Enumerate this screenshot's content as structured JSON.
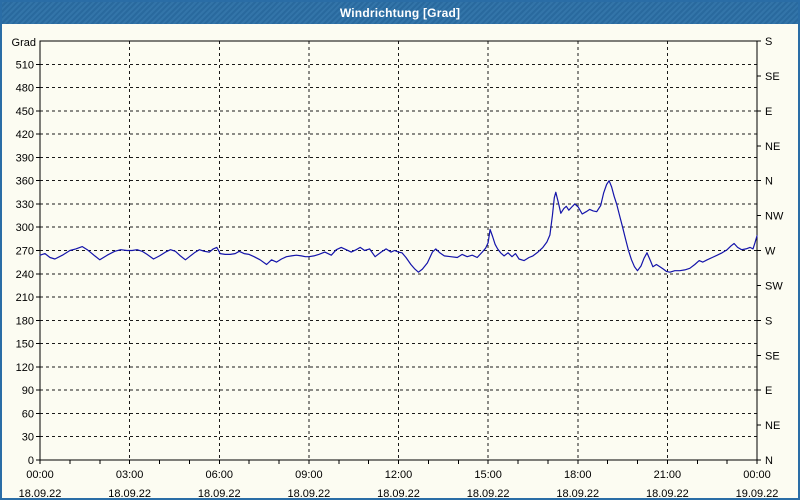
{
  "window": {
    "title": "Windrichtung [Grad]"
  },
  "colors": {
    "titlebar": "#2b6fa6",
    "window_border": "#2a6da6",
    "background": "#fcfcf2",
    "plot_border": "#000000",
    "gridline": "#1a1a1a",
    "axis_text": "#000000",
    "series_line": "#1414aa"
  },
  "chart_data": {
    "type": "line",
    "title": "Windrichtung [Grad]",
    "ylabel_left": "Grad",
    "xlabel": "",
    "grid": true,
    "legend": "none",
    "y_axis_left": {
      "min": 0,
      "max": 540,
      "tick_step": 30,
      "tick_labels": [
        "0",
        "30",
        "60",
        "90",
        "120",
        "150",
        "180",
        "210",
        "240",
        "270",
        "300",
        "330",
        "360",
        "390",
        "420",
        "450",
        "480",
        "510"
      ]
    },
    "y_axis_right": {
      "labels": [
        {
          "value": 0,
          "label": "N"
        },
        {
          "value": 45,
          "label": "NE"
        },
        {
          "value": 90,
          "label": "E"
        },
        {
          "value": 135,
          "label": "SE"
        },
        {
          "value": 180,
          "label": "S"
        },
        {
          "value": 225,
          "label": "SW"
        },
        {
          "value": 270,
          "label": "W"
        },
        {
          "value": 315,
          "label": "NW"
        },
        {
          "value": 360,
          "label": "N"
        },
        {
          "value": 405,
          "label": "NE"
        },
        {
          "value": 450,
          "label": "E"
        },
        {
          "value": 495,
          "label": "SE"
        },
        {
          "value": 540,
          "label": "S"
        }
      ]
    },
    "x_axis": {
      "minutes_total": 1440,
      "minor_tick_hours": 1,
      "ticks": [
        {
          "hour": 0,
          "time": "00:00",
          "date": "18.09.22"
        },
        {
          "hour": 3,
          "time": "03:00",
          "date": "18.09.22"
        },
        {
          "hour": 6,
          "time": "06:00",
          "date": "18.09.22"
        },
        {
          "hour": 9,
          "time": "09:00",
          "date": "18.09.22"
        },
        {
          "hour": 12,
          "time": "12:00",
          "date": "18.09.22"
        },
        {
          "hour": 15,
          "time": "15:00",
          "date": "18.09.22"
        },
        {
          "hour": 18,
          "time": "18:00",
          "date": "18.09.22"
        },
        {
          "hour": 21,
          "time": "21:00",
          "date": "18.09.22"
        },
        {
          "hour": 24,
          "time": "00:00",
          "date": "19.09.22"
        }
      ]
    },
    "series": [
      {
        "name": "Windrichtung",
        "unit": "Grad",
        "points": [
          [
            0,
            264
          ],
          [
            10,
            266
          ],
          [
            20,
            261
          ],
          [
            30,
            259
          ],
          [
            45,
            264
          ],
          [
            60,
            270
          ],
          [
            72,
            272
          ],
          [
            85,
            275
          ],
          [
            95,
            271
          ],
          [
            110,
            263
          ],
          [
            120,
            258
          ],
          [
            135,
            264
          ],
          [
            150,
            269
          ],
          [
            162,
            271
          ],
          [
            175,
            270
          ],
          [
            185,
            270
          ],
          [
            195,
            271
          ],
          [
            205,
            269
          ],
          [
            215,
            265
          ],
          [
            228,
            259
          ],
          [
            240,
            263
          ],
          [
            252,
            268
          ],
          [
            262,
            271
          ],
          [
            272,
            269
          ],
          [
            282,
            263
          ],
          [
            292,
            258
          ],
          [
            300,
            262
          ],
          [
            310,
            267
          ],
          [
            320,
            271
          ],
          [
            330,
            269
          ],
          [
            340,
            268
          ],
          [
            348,
            272
          ],
          [
            355,
            274
          ],
          [
            362,
            266
          ],
          [
            372,
            265
          ],
          [
            382,
            265
          ],
          [
            392,
            266
          ],
          [
            400,
            269
          ],
          [
            410,
            266
          ],
          [
            420,
            265
          ],
          [
            430,
            262
          ],
          [
            442,
            258
          ],
          [
            455,
            252
          ],
          [
            465,
            258
          ],
          [
            475,
            255
          ],
          [
            485,
            259
          ],
          [
            495,
            262
          ],
          [
            505,
            263
          ],
          [
            515,
            264
          ],
          [
            525,
            263
          ],
          [
            533,
            262
          ],
          [
            540,
            262
          ],
          [
            550,
            263
          ],
          [
            560,
            265
          ],
          [
            572,
            268
          ],
          [
            585,
            264
          ],
          [
            595,
            271
          ],
          [
            605,
            274
          ],
          [
            615,
            271
          ],
          [
            625,
            268
          ],
          [
            635,
            271
          ],
          [
            643,
            274
          ],
          [
            652,
            270
          ],
          [
            662,
            272
          ],
          [
            673,
            262
          ],
          [
            685,
            268
          ],
          [
            695,
            272
          ],
          [
            705,
            268
          ],
          [
            712,
            270
          ],
          [
            720,
            268
          ],
          [
            727,
            267
          ],
          [
            735,
            261
          ],
          [
            745,
            252
          ],
          [
            753,
            246
          ],
          [
            760,
            242
          ],
          [
            768,
            246
          ],
          [
            778,
            254
          ],
          [
            788,
            268
          ],
          [
            795,
            272
          ],
          [
            803,
            267
          ],
          [
            812,
            263
          ],
          [
            825,
            262
          ],
          [
            838,
            261
          ],
          [
            848,
            265
          ],
          [
            858,
            262
          ],
          [
            868,
            264
          ],
          [
            878,
            261
          ],
          [
            888,
            268
          ],
          [
            895,
            273
          ],
          [
            900,
            280
          ],
          [
            904,
            297
          ],
          [
            909,
            288
          ],
          [
            914,
            278
          ],
          [
            919,
            272
          ],
          [
            925,
            267
          ],
          [
            932,
            263
          ],
          [
            940,
            267
          ],
          [
            948,
            262
          ],
          [
            955,
            266
          ],
          [
            962,
            259
          ],
          [
            972,
            257
          ],
          [
            982,
            261
          ],
          [
            990,
            263
          ],
          [
            1000,
            268
          ],
          [
            1010,
            274
          ],
          [
            1018,
            281
          ],
          [
            1024,
            290
          ],
          [
            1029,
            315
          ],
          [
            1033,
            338
          ],
          [
            1036,
            345
          ],
          [
            1041,
            332
          ],
          [
            1046,
            318
          ],
          [
            1052,
            324
          ],
          [
            1057,
            327
          ],
          [
            1062,
            322
          ],
          [
            1068,
            326
          ],
          [
            1074,
            330
          ],
          [
            1081,
            326
          ],
          [
            1089,
            317
          ],
          [
            1097,
            320
          ],
          [
            1104,
            323
          ],
          [
            1111,
            321
          ],
          [
            1118,
            320
          ],
          [
            1126,
            328
          ],
          [
            1132,
            344
          ],
          [
            1138,
            355
          ],
          [
            1143,
            360
          ],
          [
            1148,
            352
          ],
          [
            1153,
            340
          ],
          [
            1158,
            330
          ],
          [
            1164,
            315
          ],
          [
            1170,
            300
          ],
          [
            1176,
            285
          ],
          [
            1182,
            270
          ],
          [
            1188,
            258
          ],
          [
            1194,
            249
          ],
          [
            1200,
            244
          ],
          [
            1207,
            250
          ],
          [
            1213,
            260
          ],
          [
            1219,
            267
          ],
          [
            1226,
            257
          ],
          [
            1231,
            249
          ],
          [
            1238,
            252
          ],
          [
            1245,
            249
          ],
          [
            1252,
            246
          ],
          [
            1258,
            243
          ],
          [
            1265,
            242
          ],
          [
            1275,
            244
          ],
          [
            1285,
            244
          ],
          [
            1295,
            245
          ],
          [
            1305,
            247
          ],
          [
            1315,
            252
          ],
          [
            1324,
            257
          ],
          [
            1331,
            255
          ],
          [
            1340,
            258
          ],
          [
            1350,
            261
          ],
          [
            1360,
            264
          ],
          [
            1370,
            267
          ],
          [
            1380,
            271
          ],
          [
            1388,
            276
          ],
          [
            1394,
            279
          ],
          [
            1401,
            274
          ],
          [
            1409,
            271
          ],
          [
            1418,
            272
          ],
          [
            1426,
            274
          ],
          [
            1432,
            272
          ],
          [
            1436,
            280
          ],
          [
            1440,
            289
          ]
        ]
      }
    ]
  }
}
